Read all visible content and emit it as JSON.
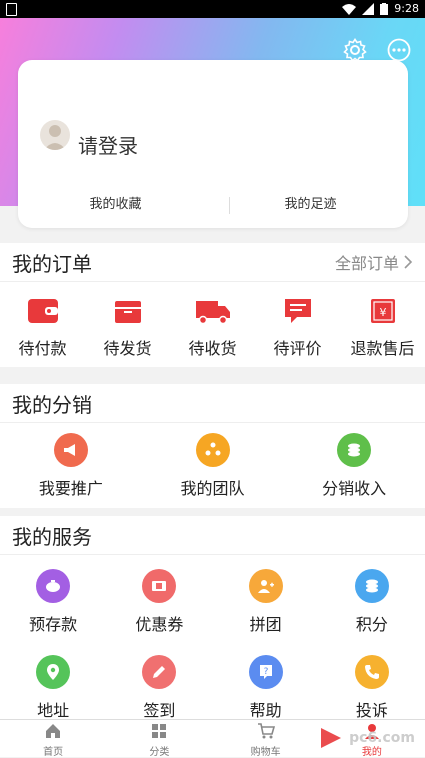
{
  "status": {
    "time": "9:28"
  },
  "account": {
    "login_prompt": "请登录",
    "favorites": "我的收藏",
    "history": "我的足迹"
  },
  "orders": {
    "title": "我的订单",
    "all_label": "全部订单",
    "items": [
      {
        "label": "待付款",
        "icon": "wallet-icon"
      },
      {
        "label": "待发货",
        "icon": "box-icon"
      },
      {
        "label": "待收货",
        "icon": "truck-icon"
      },
      {
        "label": "待评价",
        "icon": "comment-icon"
      },
      {
        "label": "退款售后",
        "icon": "refund-icon"
      }
    ],
    "color": "#e8393b"
  },
  "distribution": {
    "title": "我的分销",
    "items": [
      {
        "label": "我要推广",
        "color": "#f06a4e",
        "icon": "megaphone-icon"
      },
      {
        "label": "我的团队",
        "color": "#f6a623",
        "icon": "team-icon"
      },
      {
        "label": "分销收入",
        "color": "#5fbf4a",
        "icon": "coins-icon"
      }
    ]
  },
  "services": {
    "title": "我的服务",
    "items": [
      {
        "label": "预存款",
        "color": "#a35fe3",
        "icon": "piggy-bank-icon"
      },
      {
        "label": "优惠券",
        "color": "#f06a6a",
        "icon": "coupon-icon"
      },
      {
        "label": "拼团",
        "color": "#f7a83a",
        "icon": "group-buy-icon"
      },
      {
        "label": "积分",
        "color": "#4aa7ef",
        "icon": "points-icon"
      },
      {
        "label": "地址",
        "color": "#55c45a",
        "icon": "location-icon"
      },
      {
        "label": "签到",
        "color": "#f07070",
        "icon": "pen-icon"
      },
      {
        "label": "帮助",
        "color": "#5b8cf0",
        "icon": "help-icon"
      },
      {
        "label": "投诉",
        "color": "#f6b12f",
        "icon": "phone-icon"
      }
    ]
  },
  "tabbar": [
    {
      "label": "首页",
      "icon": "home-icon"
    },
    {
      "label": "分类",
      "icon": "grid-icon"
    },
    {
      "label": "购物车",
      "icon": "cart-icon"
    },
    {
      "label": "我的",
      "icon": "user-icon"
    }
  ],
  "watermark": "pc6.com"
}
